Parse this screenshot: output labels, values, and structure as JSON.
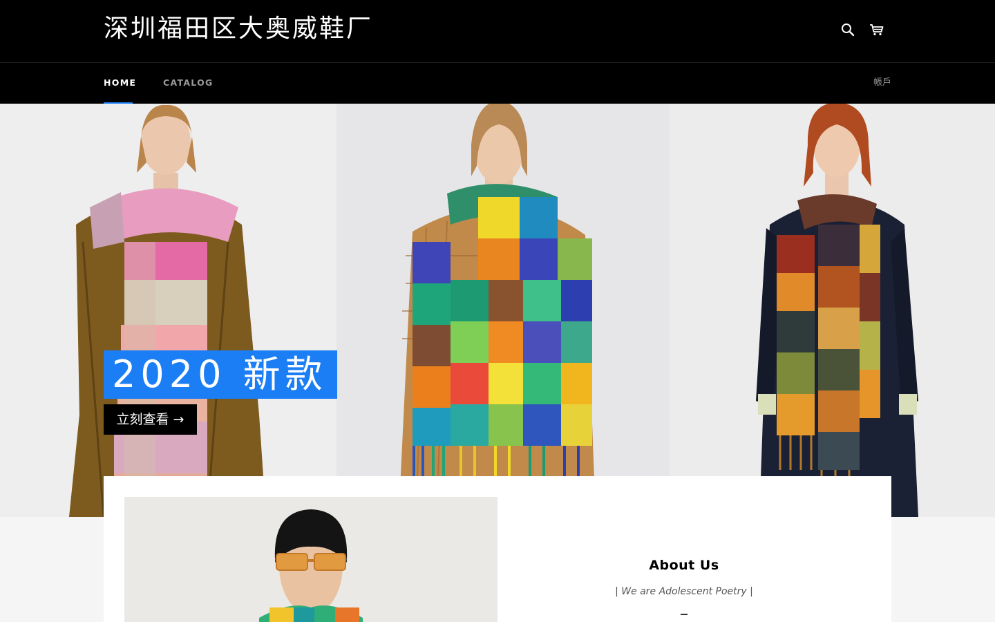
{
  "header": {
    "logo": "深圳福田区大奥威鞋厂",
    "search_icon": "search-icon",
    "cart_icon": "cart-icon"
  },
  "nav": {
    "home": "HOME",
    "catalog": "CATALOG",
    "account": "帳戶"
  },
  "hero": {
    "title": "2020 新款",
    "button": "立刻查看 →"
  },
  "about": {
    "title": "About Us",
    "subtitle": "| We are Adolescent Poetry |"
  },
  "colors": {
    "accent": "#1c7ef5",
    "header_bg": "#000000",
    "page_bg": "#f5f5f5"
  }
}
